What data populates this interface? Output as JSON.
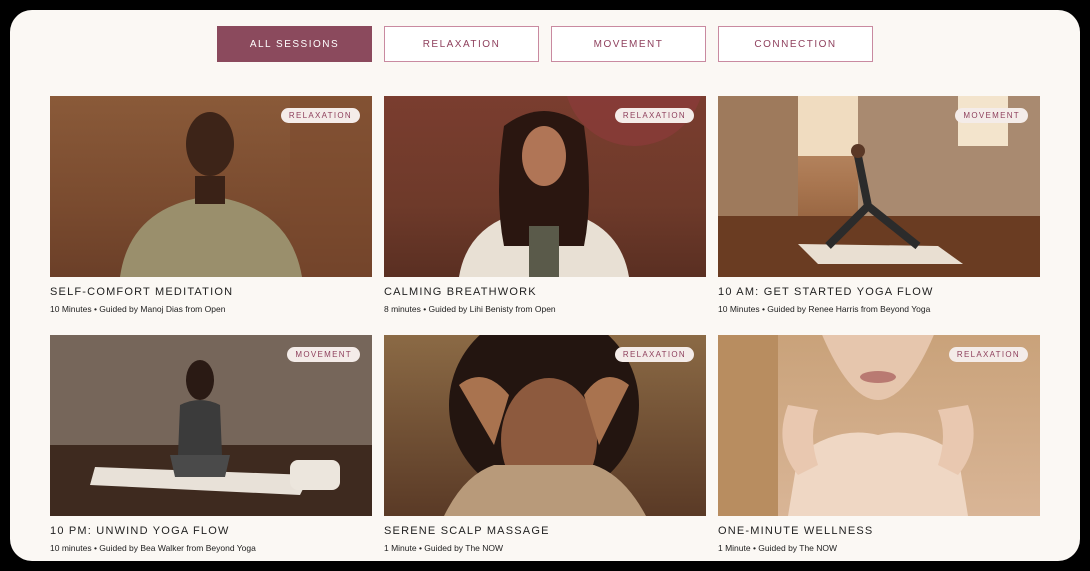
{
  "filters": [
    {
      "label": "ALL SESSIONS",
      "active": true
    },
    {
      "label": "RELAXATION",
      "active": false
    },
    {
      "label": "MOVEMENT",
      "active": false
    },
    {
      "label": "CONNECTION",
      "active": false
    }
  ],
  "cards": [
    {
      "badge": "RELAXATION",
      "title": "SELF-COMFORT MEDITATION",
      "meta": "10 Minutes • Guided by Manoj Dias from Open"
    },
    {
      "badge": "RELAXATION",
      "title": "CALMING BREATHWORK",
      "meta": "8 minutes • Guided by Lihi Benisty from Open"
    },
    {
      "badge": "MOVEMENT",
      "title": "10 AM: GET STARTED YOGA FLOW",
      "meta": "10 Minutes • Guided by Renee Harris from Beyond Yoga"
    },
    {
      "badge": "MOVEMENT",
      "title": "10 PM: UNWIND YOGA FLOW",
      "meta": "10 minutes • Guided by Bea Walker from Beyond Yoga"
    },
    {
      "badge": "RELAXATION",
      "title": "SERENE SCALP MASSAGE",
      "meta": "1 Minute • Guided by The NOW"
    },
    {
      "badge": "RELAXATION",
      "title": "ONE-MINUTE WELLNESS",
      "meta": "1 Minute • Guided by The NOW"
    }
  ]
}
